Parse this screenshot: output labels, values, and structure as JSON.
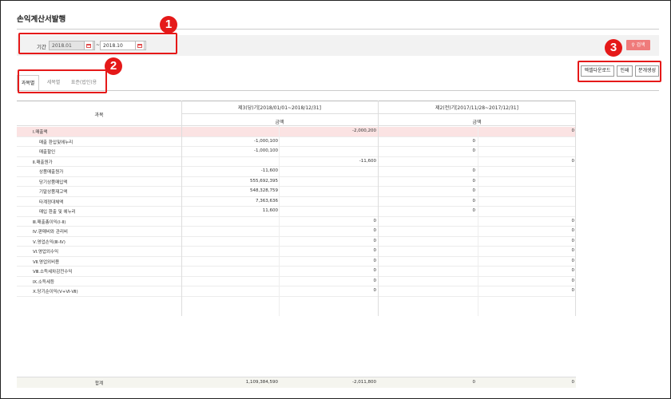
{
  "page": {
    "title": "손익계산서발행"
  },
  "search": {
    "period_label": "기간",
    "from": "2018.01",
    "separator": "~",
    "to": "2018.10",
    "button": "검색",
    "button_icon": "search-icon"
  },
  "tabs": [
    {
      "label": "과목별",
      "active": true
    },
    {
      "label": "세목별",
      "active": false
    },
    {
      "label": "표준(법인)용",
      "active": false
    }
  ],
  "actions": {
    "excel": "엑셀다운로드",
    "print": "인쇄",
    "issue": "분개생성"
  },
  "callouts": [
    "1",
    "2",
    "3"
  ],
  "table": {
    "col_subject": "과목",
    "period_current": "제3(당)기[2018/01/01~2018/12/31]",
    "period_prior": "제2(전)기[2017/11/28~2017/12/31]",
    "amount_label": "금액",
    "rows": [
      {
        "label": "Ⅰ.매출액",
        "indent": 0,
        "c1": "",
        "c2": "-2,000,200",
        "p1": "",
        "p2": "0"
      },
      {
        "label": "매출 환입및에누리",
        "indent": 1,
        "c1": "-1,000,100",
        "c2": "",
        "p1": "0",
        "p2": ""
      },
      {
        "label": "매출할인",
        "indent": 1,
        "c1": "-1,000,100",
        "c2": "",
        "p1": "0",
        "p2": ""
      },
      {
        "label": "Ⅱ.매출원가",
        "indent": 0,
        "c1": "",
        "c2": "-11,600",
        "p1": "",
        "p2": "0"
      },
      {
        "label": "상품매출원가",
        "indent": 1,
        "c1": "-11,600",
        "c2": "",
        "p1": "0",
        "p2": ""
      },
      {
        "label": "당기상품매입액",
        "indent": 1,
        "c1": "555,692,395",
        "c2": "",
        "p1": "0",
        "p2": ""
      },
      {
        "label": "기말상품재고액",
        "indent": 1,
        "c1": "548,328,759",
        "c2": "",
        "p1": "0",
        "p2": ""
      },
      {
        "label": "타계정대체액",
        "indent": 1,
        "c1": "7,363,636",
        "c2": "",
        "p1": "0",
        "p2": ""
      },
      {
        "label": "매입 환출 및 에누리",
        "indent": 1,
        "c1": "11,600",
        "c2": "",
        "p1": "0",
        "p2": ""
      },
      {
        "label": "Ⅲ.매출총이익(Ⅰ-Ⅱ)",
        "indent": 0,
        "c1": "",
        "c2": "0",
        "p1": "",
        "p2": "0"
      },
      {
        "label": "Ⅳ.판매비와 관리비",
        "indent": 0,
        "c1": "",
        "c2": "0",
        "p1": "",
        "p2": "0"
      },
      {
        "label": "Ⅴ.영업손익(Ⅲ-Ⅳ)",
        "indent": 0,
        "c1": "",
        "c2": "0",
        "p1": "",
        "p2": "0"
      },
      {
        "label": "Ⅵ.영업외수익",
        "indent": 0,
        "c1": "",
        "c2": "0",
        "p1": "",
        "p2": "0"
      },
      {
        "label": "Ⅶ.영업외비용",
        "indent": 0,
        "c1": "",
        "c2": "0",
        "p1": "",
        "p2": "0"
      },
      {
        "label": "Ⅷ.소득세차감전수익",
        "indent": 0,
        "c1": "",
        "c2": "0",
        "p1": "",
        "p2": "0"
      },
      {
        "label": "Ⅸ.소득세등",
        "indent": 0,
        "c1": "",
        "c2": "0",
        "p1": "",
        "p2": "0"
      },
      {
        "label": "Ⅹ.당기순이익(Ⅴ+Ⅵ-Ⅶ)",
        "indent": 0,
        "c1": "",
        "c2": "0",
        "p1": "",
        "p2": "0"
      }
    ],
    "footer": {
      "label": "합계",
      "c1": "1,109,384,590",
      "c2": "-2,011,800",
      "p1": "0",
      "p2": "0"
    }
  },
  "colors": {
    "callout": "#e51919",
    "search_button": "#ef7b7b",
    "first_row": "#fbe3e3"
  }
}
